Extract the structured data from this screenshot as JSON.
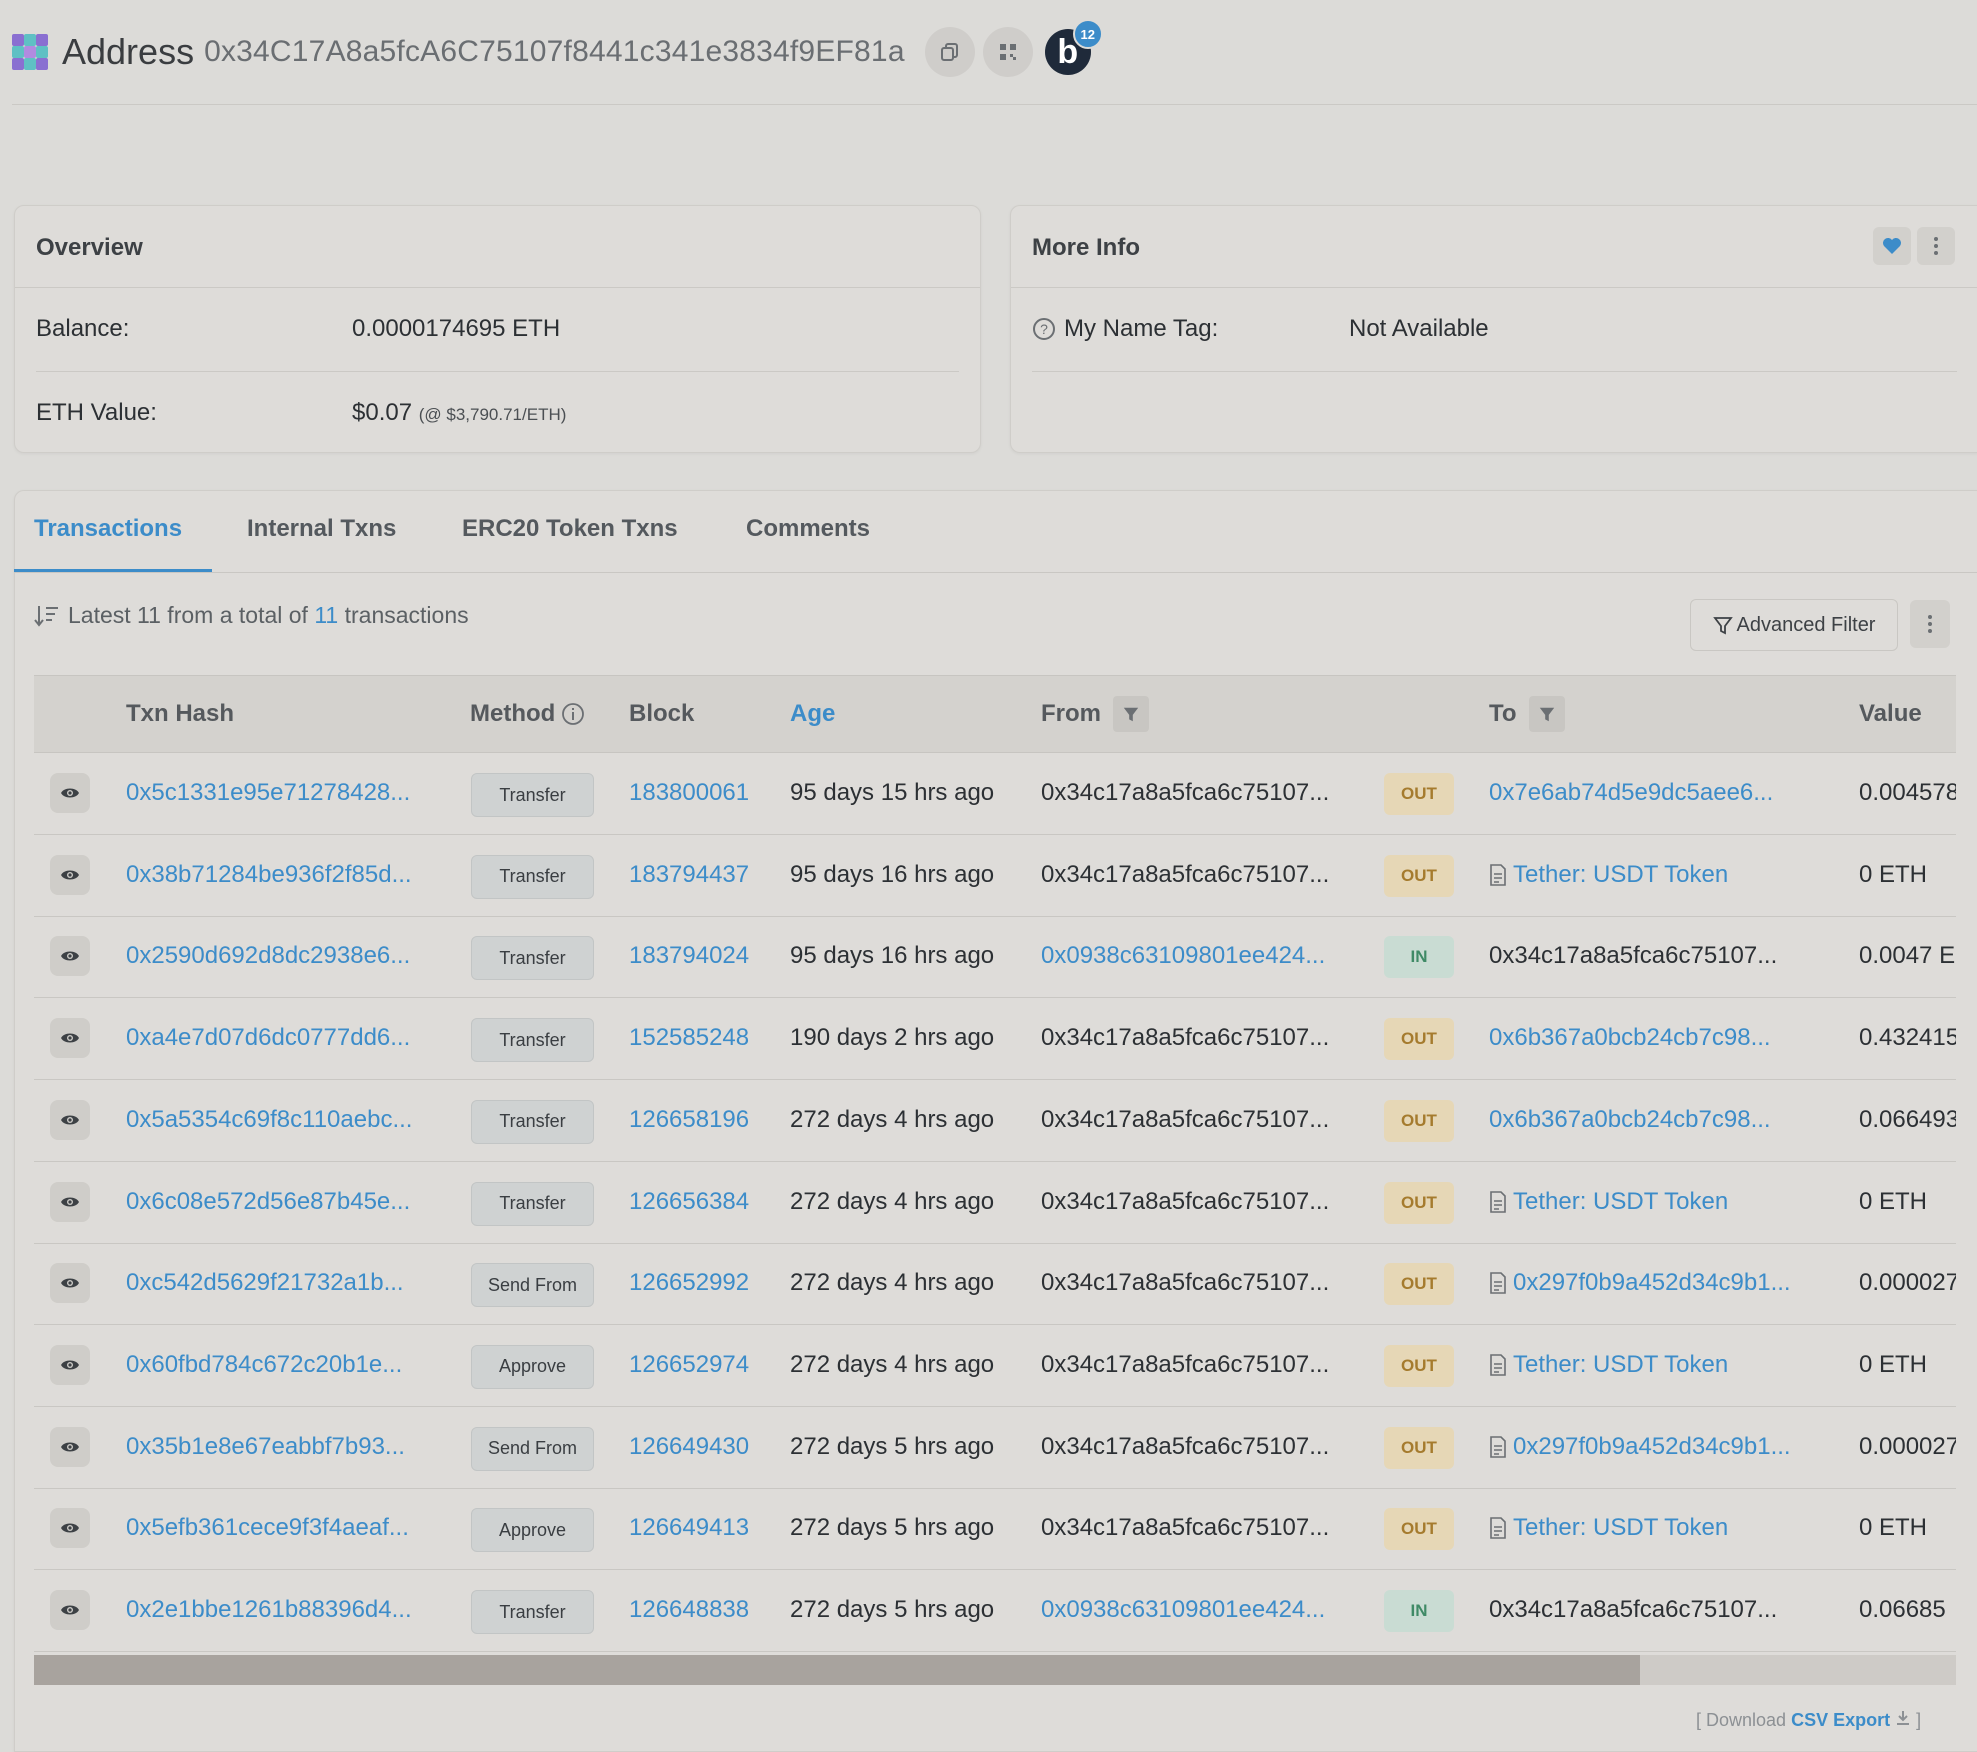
{
  "header": {
    "title": "Address",
    "address": "0x34C17A8a5fcA6C75107f8441c341e3834f9EF81a",
    "notification_count": "12",
    "blockscan_letter": "b"
  },
  "overview": {
    "title": "Overview",
    "balance_label": "Balance:",
    "balance_value": "0.0000174695 ETH",
    "eth_value_label": "ETH Value:",
    "eth_value": "$0.07",
    "eth_price_note": "(@ $3,790.71/ETH)"
  },
  "more_info": {
    "title": "More Info",
    "name_tag_label": "My Name Tag:",
    "name_tag_value": "Not Available"
  },
  "tabs": [
    {
      "label": "Transactions",
      "active": true
    },
    {
      "label": "Internal Txns",
      "active": false
    },
    {
      "label": "ERC20 Token Txns",
      "active": false
    },
    {
      "label": "Comments",
      "active": false
    }
  ],
  "summary": {
    "prefix": "Latest 11 from a total of",
    "count": "11",
    "suffix": "transactions"
  },
  "toolbar": {
    "advanced_filter_label": "Advanced Filter"
  },
  "table": {
    "columns": {
      "txn_hash": "Txn Hash",
      "method": "Method",
      "block": "Block",
      "age": "Age",
      "from": "From",
      "to": "To",
      "value": "Value"
    },
    "rows": [
      {
        "hash": "0x5c1331e95e71278428...",
        "method": "Transfer",
        "block": "183800061",
        "age": "95 days 15 hrs ago",
        "from": "0x34c17a8a5fca6c75107...",
        "from_link": false,
        "dir": "OUT",
        "to": "0x7e6ab74d5e9dc5aee6...",
        "to_link": true,
        "to_contract": false,
        "value": "0.004578"
      },
      {
        "hash": "0x38b71284be936f2f85d...",
        "method": "Transfer",
        "block": "183794437",
        "age": "95 days 16 hrs ago",
        "from": "0x34c17a8a5fca6c75107...",
        "from_link": false,
        "dir": "OUT",
        "to": "Tether: USDT Token",
        "to_link": true,
        "to_contract": true,
        "value": "0 ETH"
      },
      {
        "hash": "0x2590d692d8dc2938e6...",
        "method": "Transfer",
        "block": "183794024",
        "age": "95 days 16 hrs ago",
        "from": "0x0938c63109801ee424...",
        "from_link": true,
        "dir": "IN",
        "to": "0x34c17a8a5fca6c75107...",
        "to_link": false,
        "to_contract": false,
        "value": "0.0047 E"
      },
      {
        "hash": "0xa4e7d07d6dc0777dd6...",
        "method": "Transfer",
        "block": "152585248",
        "age": "190 days 2 hrs ago",
        "from": "0x34c17a8a5fca6c75107...",
        "from_link": false,
        "dir": "OUT",
        "to": "0x6b367a0bcb24cb7c98...",
        "to_link": true,
        "to_contract": false,
        "value": "0.432415"
      },
      {
        "hash": "0x5a5354c69f8c110aebc...",
        "method": "Transfer",
        "block": "126658196",
        "age": "272 days 4 hrs ago",
        "from": "0x34c17a8a5fca6c75107...",
        "from_link": false,
        "dir": "OUT",
        "to": "0x6b367a0bcb24cb7c98...",
        "to_link": true,
        "to_contract": false,
        "value": "0.066493"
      },
      {
        "hash": "0x6c08e572d56e87b45e...",
        "method": "Transfer",
        "block": "126656384",
        "age": "272 days 4 hrs ago",
        "from": "0x34c17a8a5fca6c75107...",
        "from_link": false,
        "dir": "OUT",
        "to": "Tether: USDT Token",
        "to_link": true,
        "to_contract": true,
        "value": "0 ETH"
      },
      {
        "hash": "0xc542d5629f21732a1b...",
        "method": "Send From",
        "block": "126652992",
        "age": "272 days 4 hrs ago",
        "from": "0x34c17a8a5fca6c75107...",
        "from_link": false,
        "dir": "OUT",
        "to": "0x297f0b9a452d34c9b1...",
        "to_link": true,
        "to_contract": true,
        "value": "0.000027"
      },
      {
        "hash": "0x60fbd784c672c20b1e...",
        "method": "Approve",
        "block": "126652974",
        "age": "272 days 4 hrs ago",
        "from": "0x34c17a8a5fca6c75107...",
        "from_link": false,
        "dir": "OUT",
        "to": "Tether: USDT Token",
        "to_link": true,
        "to_contract": true,
        "value": "0 ETH"
      },
      {
        "hash": "0x35b1e8e67eabbf7b93...",
        "method": "Send From",
        "block": "126649430",
        "age": "272 days 5 hrs ago",
        "from": "0x34c17a8a5fca6c75107...",
        "from_link": false,
        "dir": "OUT",
        "to": "0x297f0b9a452d34c9b1...",
        "to_link": true,
        "to_contract": true,
        "value": "0.000027"
      },
      {
        "hash": "0x5efb361cece9f3f4aeaf...",
        "method": "Approve",
        "block": "126649413",
        "age": "272 days 5 hrs ago",
        "from": "0x34c17a8a5fca6c75107...",
        "from_link": false,
        "dir": "OUT",
        "to": "Tether: USDT Token",
        "to_link": true,
        "to_contract": true,
        "value": "0 ETH"
      },
      {
        "hash": "0x2e1bbe1261b88396d4...",
        "method": "Transfer",
        "block": "126648838",
        "age": "272 days 5 hrs ago",
        "from": "0x0938c63109801ee424...",
        "from_link": true,
        "dir": "IN",
        "to": "0x34c17a8a5fca6c75107...",
        "to_link": false,
        "to_contract": false,
        "value": "0.06685"
      }
    ]
  },
  "footer": {
    "download_prefix": "[ Download",
    "csv_label": "CSV Export",
    "download_suffix": "]"
  },
  "colors": {
    "accent": "#3c8cc9",
    "out_badge": "#e6d7b6",
    "in_badge": "#c9dcd3"
  },
  "icons": {
    "copy": "copy-icon",
    "qr": "qr-code-icon",
    "heart": "heart-icon",
    "kebab": "kebab-menu-icon",
    "eye": "eye-icon",
    "filter": "filter-icon",
    "doc": "contract-doc-icon",
    "download": "download-icon",
    "sort": "sort-icon",
    "info": "info-icon",
    "help": "question-icon"
  }
}
